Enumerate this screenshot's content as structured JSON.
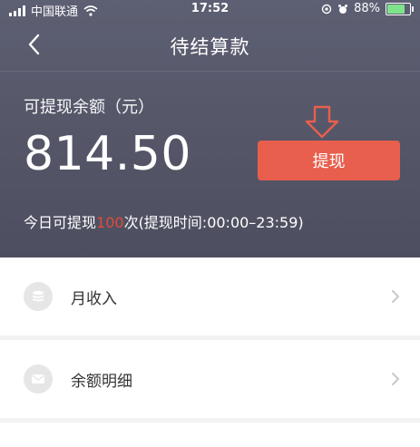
{
  "status_bar": {
    "carrier": "中国联通",
    "time": "17:52",
    "battery": "88%",
    "battery_level": 0.88
  },
  "nav": {
    "title": "待结算款"
  },
  "balance": {
    "label": "可提现余额（元）",
    "amount": "814.50",
    "withdraw_label": "提现",
    "note_prefix": "今日可提现",
    "note_count": "100",
    "note_suffix": "次(提现时间:00:00–23:59)"
  },
  "list": [
    {
      "label": "月收入",
      "icon": "coins-icon"
    },
    {
      "label": "余额明细",
      "icon": "envelope-icon"
    }
  ],
  "colors": {
    "header": "#56586a",
    "accent": "#e85f4d",
    "count": "#e34a3b"
  }
}
